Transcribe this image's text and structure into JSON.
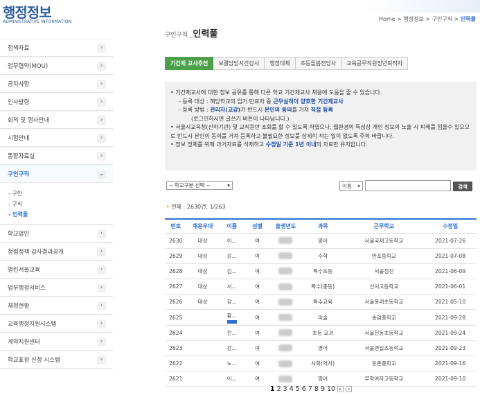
{
  "site": {
    "title": "행정정보",
    "subtitle": "ADMINISTRATIVE INFORMATION"
  },
  "sidebar": {
    "items": [
      {
        "label": "정책자료"
      },
      {
        "label": "업무협약(MOU)"
      },
      {
        "label": "공지사항"
      },
      {
        "label": "인사발령"
      },
      {
        "label": "회의 및 행사안내"
      },
      {
        "label": "시험안내"
      },
      {
        "label": "통합자료실"
      },
      {
        "label": "구인구직"
      },
      {
        "label": "학교법인"
      },
      {
        "label": "청렴정책·감사결과공개"
      },
      {
        "label": "열린서울교육"
      },
      {
        "label": "법무행정서비스"
      },
      {
        "label": "재정현황"
      },
      {
        "label": "교육행정지원시스템"
      },
      {
        "label": "계약지원센터"
      },
      {
        "label": "학교표창 신청 시스템"
      }
    ],
    "sub_items": [
      {
        "label": "- 구인"
      },
      {
        "label": "- 구직"
      },
      {
        "label": "- 인력풀"
      }
    ]
  },
  "breadcrumb": {
    "home": "Home",
    "sep": ">",
    "l1": "행정정보",
    "l2": "구인구직",
    "current": "인력풀"
  },
  "page": {
    "category": "구인구직",
    "title": "인력풀"
  },
  "tabs": [
    {
      "label": "기간제 교사추천"
    },
    {
      "label": "보결담당시간강사"
    },
    {
      "label": "행정대체"
    },
    {
      "label": "초등돌봄전담사"
    },
    {
      "label": "교육공무직원정년퇴직자"
    }
  ],
  "notice": {
    "line1": "• 기간제교사에 대한 정보 공유를 통해 다른 학교 기간제교사 채용에 도움을 줄 수 있습니다.",
    "line2a": "- 등록 대상 : 해당학교의 임기 만료자 중 ",
    "line2b": "근무실적이 양호한 기간제교사",
    "line3a": "- 등록 방법 : ",
    "line3b": "관리자(교감)",
    "line3c": "가 반드시 ",
    "line3d": "본인의 동의",
    "line3e": "를 거쳐 ",
    "line3f": "직접 등록",
    "line4": "(로그인하시면 글쓰기 버튼이 나타납니다.)",
    "line5": "• 서울시교육청(산하기관) 및 교직원만 조회를 할 수 있도록 하였으나, 웹환경의 특성상 개인 정보의 노출 시 피해를 입을수 있으므로 반드시 본인의 동의를 거쳐 등록하고 불필요한 정보를 상세히 적는 일이 없도록 주의 바랍니다.",
    "line6a": "• 정보 정체를 위해 과거자료를 삭제하고 ",
    "line6b": "수정일 기준 1년 이내",
    "line6c": "의 자료만 유지합니다."
  },
  "filter": {
    "school_select": "-- 학교구분 선택 --",
    "search_field": "이름",
    "search_button": "검색"
  },
  "total": {
    "label": "전체 : 2630건, 1/263"
  },
  "table": {
    "headers": [
      "번호",
      "채용우대",
      "이름",
      "성별",
      "출생년도",
      "과목",
      "근무학교",
      "수정일"
    ],
    "rows": [
      {
        "no": "2630",
        "pref": "대상",
        "name": "이...",
        "sex": "여",
        "subject": "영어",
        "school": "서울국제고등학교",
        "date": "2021-07-26"
      },
      {
        "no": "2629",
        "pref": "대상",
        "name": "윤...",
        "sex": "여",
        "subject": "수학",
        "school": "반포중학교",
        "date": "2021-07-08"
      },
      {
        "no": "2628",
        "pref": "대상",
        "name": "김...",
        "sex": "여",
        "subject": "특수초등",
        "school": "서울정진",
        "date": "2021-06-09"
      },
      {
        "no": "2627",
        "pref": "대상",
        "name": "서...",
        "sex": "여",
        "subject": "특수(중등)",
        "school": "신서고등학교",
        "date": "2021-06-01"
      },
      {
        "no": "2626",
        "pref": "대상",
        "name": "강...",
        "sex": "여",
        "subject": "특수교육",
        "school": "서울봉래초등학교",
        "date": "2021-05-10"
      },
      {
        "no": "2625",
        "pref": "",
        "name": "황...",
        "sex": "여",
        "subject": "미술",
        "school": "송암중학교",
        "date": "2021-09-28"
      },
      {
        "no": "2624",
        "pref": "",
        "name": "전...",
        "sex": "여",
        "subject": "초등 교과",
        "school": "서울천동초등학교",
        "date": "2021-09-24"
      },
      {
        "no": "2623",
        "pref": "",
        "name": "강...",
        "sex": "여",
        "subject": "영어",
        "school": "서울면일초등학교",
        "date": "2021-09-23"
      },
      {
        "no": "2622",
        "pref": "",
        "name": "노...",
        "sex": "여",
        "subject": "사회(역사)",
        "school": "둔촌중학교",
        "date": "2021-09-16"
      },
      {
        "no": "2621",
        "pref": "",
        "name": "이...",
        "sex": "여",
        "subject": "영어",
        "school": "무학여자고등학교",
        "date": "2021-09-10"
      }
    ]
  },
  "pagination": {
    "pages": [
      "1",
      "2",
      "3",
      "4",
      "5",
      "6",
      "7",
      "8",
      "9",
      "10"
    ],
    "next": "▸",
    "last": "»"
  }
}
